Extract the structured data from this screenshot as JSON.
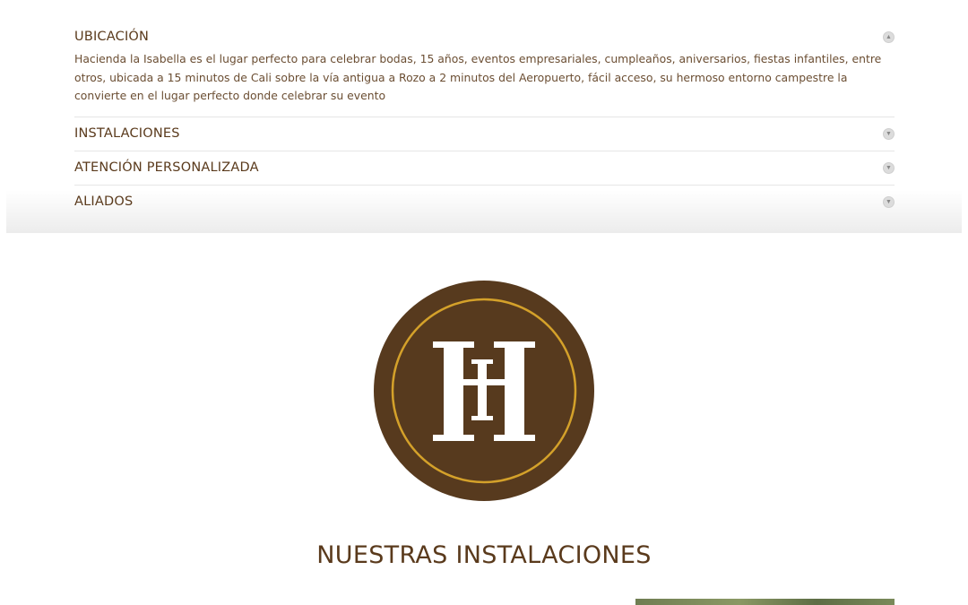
{
  "accordion": {
    "items": [
      {
        "title": "UBICACIÓN",
        "toggle_icon": "chevron-up-icon",
        "open": true,
        "body": "Hacienda la Isabella es el lugar perfecto para celebrar bodas, 15 años, eventos empresariales, cumpleaños, aniversarios, fiestas infantiles, entre otros, ubicada a 15 minutos de Cali sobre la vía antigua a Rozo a 2 minutos del Aeropuerto, fácil acceso, su hermoso entorno campestre la convierte en el lugar perfecto donde celebrar su evento"
      },
      {
        "title": "INSTALACIONES",
        "toggle_icon": "chevron-down-icon",
        "open": false
      },
      {
        "title": "ATENCIÓN PERSONALIZADA",
        "toggle_icon": "chevron-down-icon",
        "open": false
      },
      {
        "title": "ALIADOS",
        "toggle_icon": "chevron-down-icon",
        "open": false
      }
    ]
  },
  "logo": {
    "monogram": "HI",
    "colors": {
      "circle": "#573a1e",
      "ring": "#d4a12a",
      "letters": "#ffffff"
    }
  },
  "facilities": {
    "title": "NUESTRAS INSTALACIONES"
  },
  "colors": {
    "brand_brown": "#5a3a1c",
    "body_text": "#6b4e33",
    "divider": "#e6e6e6"
  }
}
